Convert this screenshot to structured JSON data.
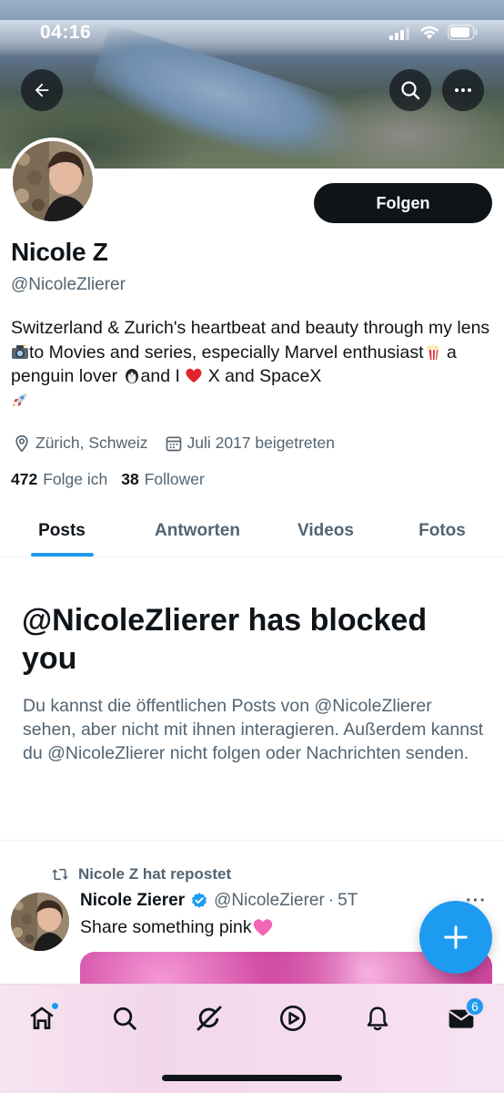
{
  "status_bar": {
    "time": "04:16"
  },
  "profile": {
    "name": "Nicole Z",
    "handle": "@NicoleZlierer",
    "follow_label": "Folgen",
    "bio_parts": [
      "Switzerland & Zurich's heartbeat and beauty through my lens ",
      "to Movies and series, especially Marvel enthusiast",
      " a penguin lover ",
      "and I ",
      " X and SpaceX"
    ],
    "location": "Zürich, Schweiz",
    "joined": "Juli 2017 beigetreten",
    "following_count": "472",
    "following_label": "Folge ich",
    "followers_count": "38",
    "followers_label": "Follower"
  },
  "tabs": [
    {
      "label": "Posts",
      "active": true
    },
    {
      "label": "Antworten",
      "active": false
    },
    {
      "label": "Videos",
      "active": false
    },
    {
      "label": "Fotos",
      "active": false
    }
  ],
  "blocked": {
    "title": "@NicoleZlierer has blocked you",
    "description": "Du kannst die öffentlichen Posts von @NicoleZlierer sehen, aber nicht mit ihnen interagieren. Außerdem kannst du @NicoleZlierer nicht folgen oder Nachrichten senden."
  },
  "post": {
    "repost_label": "Nicole Z hat repostet",
    "author_name": "Nicole Zierer",
    "author_handle": "@NicoleZierer",
    "separator": "·",
    "time": "5T",
    "more": "···",
    "text": "Share something pink "
  },
  "nav": {
    "mail_badge": "6"
  },
  "colors": {
    "accent": "#1d9bf0",
    "text": "#0f1419",
    "muted": "#536471"
  },
  "icons": [
    "back-arrow-icon",
    "search-icon",
    "more-icon",
    "location-icon",
    "calendar-icon",
    "repost-icon",
    "verified-badge-icon",
    "compose-plus-icon",
    "home-icon",
    "grok-icon",
    "video-play-icon",
    "bell-icon",
    "mail-icon"
  ]
}
